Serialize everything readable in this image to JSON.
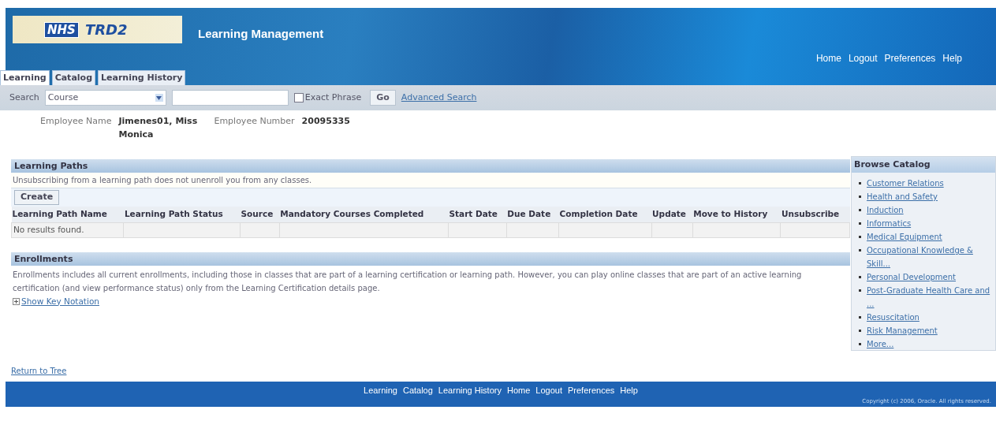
{
  "header": {
    "logo_badge": "NHS",
    "logo_text": "TRD2",
    "app_title": "Learning Management",
    "global_links": [
      "Home",
      "Logout",
      "Preferences",
      "Help"
    ]
  },
  "tabs": [
    {
      "label": "Learning",
      "selected": true
    },
    {
      "label": "Catalog",
      "selected": false
    },
    {
      "label": "Learning History",
      "selected": false
    }
  ],
  "search": {
    "label": "Search",
    "type_value": "Course",
    "exact_phrase": {
      "label": "Exact Phrase",
      "checked": false
    },
    "go": "Go",
    "advanced": "Advanced Search"
  },
  "employee": {
    "name_label": "Employee Name",
    "name": "Jimenes01, Miss Monica",
    "number_label": "Employee Number",
    "number": "20095335"
  },
  "learning_paths": {
    "title": "Learning Paths",
    "note": "Unsubscribing from a learning path does not unenroll you from any classes.",
    "create": "Create",
    "columns": [
      "Learning Path Name",
      "Learning Path Status",
      "Source",
      "Mandatory Courses Completed",
      "Start Date",
      "Due Date",
      "Completion Date",
      "Update",
      "Move to History",
      "Unsubscribe"
    ],
    "empty": "No results found."
  },
  "enrollments": {
    "title": "Enrollments",
    "note": "Enrollments includes all current enrollments, including those in classes that are part of a learning certification or learning path. However, you can play online classes that are part of an active learning certification (and view performance status) only from the Learning Certification details page.",
    "key_notation": {
      "label": "Show Key Notation",
      "expanded": false
    }
  },
  "browse_catalog": {
    "title": "Browse Catalog",
    "items": [
      "Customer Relations",
      "Health and Safety",
      "Induction",
      "Informatics",
      "Medical Equipment",
      "Occupational Knowledge & Skill...",
      "Personal Development",
      "Post-Graduate Health Care and ...",
      "Resuscitation",
      "Risk Management",
      "More..."
    ]
  },
  "return_link": "Return to Tree",
  "footer": {
    "links": [
      "Learning",
      "Catalog",
      "Learning History",
      "Home",
      "Logout",
      "Preferences",
      "Help"
    ],
    "copyright": "Copyright (c) 2006, Oracle. All rights reserved."
  }
}
